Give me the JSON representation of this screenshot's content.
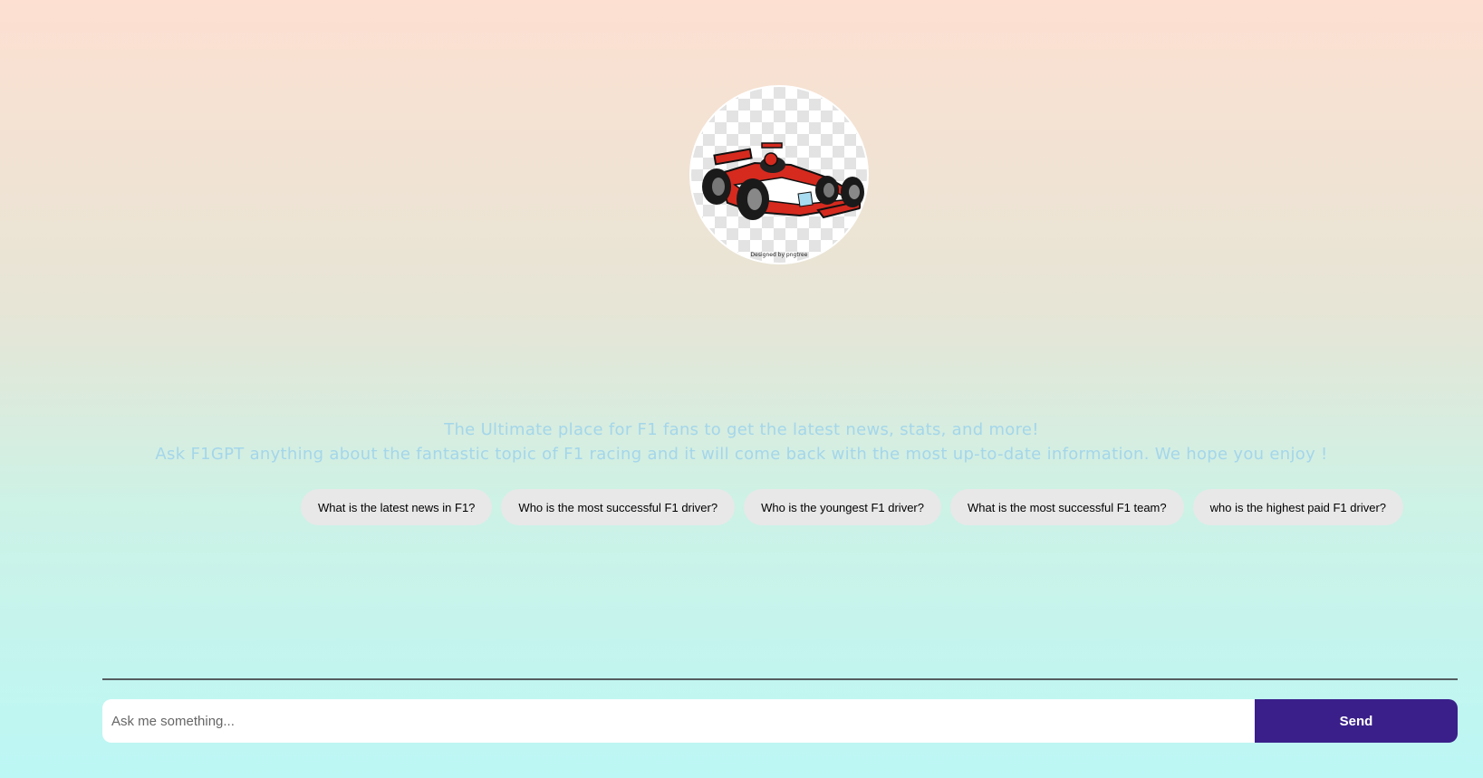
{
  "logo": {
    "icon": "f1-race-car-icon",
    "watermark": "Designed by pngtree"
  },
  "tagline": {
    "line1": "The Ultimate place for F1 fans to get the latest news, stats, and more!",
    "line2": "Ask F1GPT anything about the fantastic topic of F1 racing and it will come back with the most up-to-date information. We hope you enjoy !"
  },
  "suggestions": [
    "What is the latest news in F1?",
    "Who is the most successful F1 driver?",
    "Who is the youngest F1 driver?",
    "What is the most successful F1 team?",
    "who is the highest paid F1 driver?"
  ],
  "composer": {
    "placeholder": "Ask me something...",
    "value": "",
    "send_label": "Send"
  },
  "colors": {
    "accent": "#3a1f8a",
    "tagline": "#a4d6ea",
    "chip_bg": "#e8e8e8"
  }
}
